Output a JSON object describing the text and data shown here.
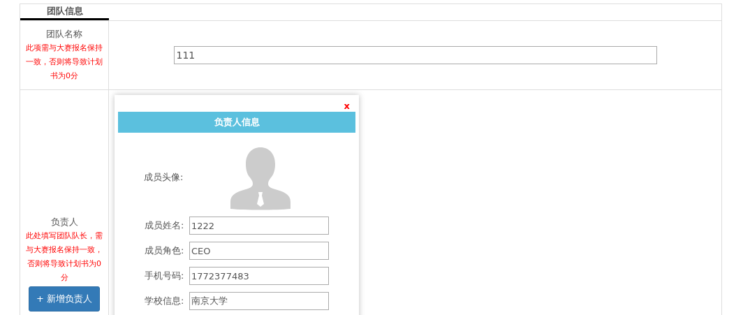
{
  "tabs": [
    {
      "label": "团队信息",
      "selected": true
    }
  ],
  "team_name": {
    "label": "团队名称",
    "note": "此项需与大赛报名保持一致，否则将导致计划书为0分",
    "value": "111"
  },
  "leader": {
    "label": "负责人",
    "note": "此处填写团队队长，需与大赛报名保持一致，否则将导致计划书为0分",
    "add_button": "+ 新增负责人"
  },
  "modal": {
    "close": "x",
    "title": "负责人信息",
    "avatar_label": "成员头像:",
    "fields": [
      {
        "label": "成员姓名:",
        "value": "1222"
      },
      {
        "label": "成员角色:",
        "value": "CEO"
      },
      {
        "label": "手机号码:",
        "value": "1772377483"
      },
      {
        "label": "学校信息:",
        "value": "南京大学"
      }
    ]
  }
}
